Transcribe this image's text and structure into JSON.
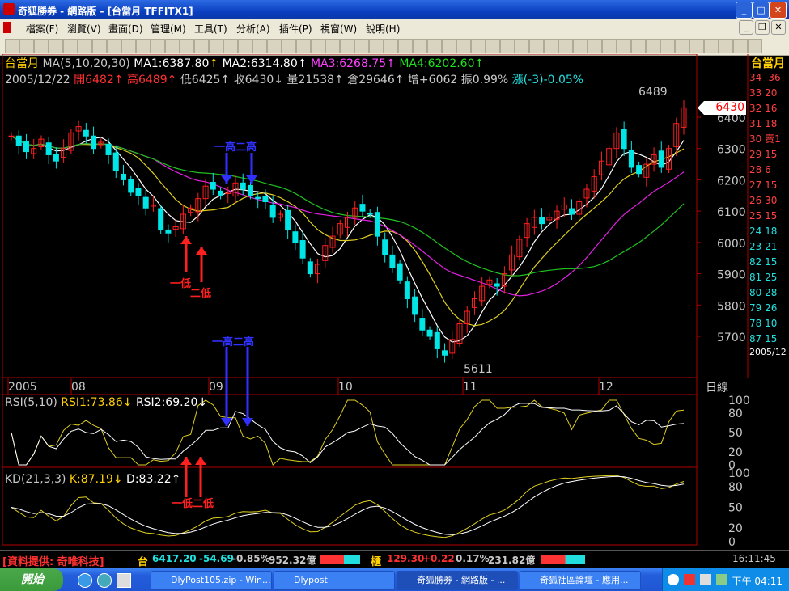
{
  "window": {
    "title": "奇狐勝券 - 網路版 - [台當月 TFFITX1]"
  },
  "menu": [
    "檔案(F)",
    "瀏覽(V)",
    "畫面(D)",
    "管理(M)",
    "工具(T)",
    "分析(A)",
    "插件(P)",
    "視窗(W)",
    "說明(H)"
  ],
  "chart_header": {
    "symbol": "台當月",
    "ma_label": "MA(5,10,20,30)",
    "ma1": "MA1:6387.80",
    "ma2": "MA2:6314.80",
    "ma3": "MA3:6268.75",
    "ma4": "MA4:6202.60",
    "date": "2005/12/22",
    "open": "開6482",
    "high": "高6489",
    "low": "低6425",
    "close": "收6430",
    "volume": "量21538",
    "oi": "倉29646",
    "oi_change": "增+6062",
    "amplitude": "振0.99%",
    "change": "漲(-3)-0.05%",
    "arrow_up": "↑",
    "arrow_down": "↓"
  },
  "annotations": {
    "high_label": "一高二高",
    "low1": "一低",
    "low2": "二低",
    "low_combined": "一低二低",
    "peak_value": "6489",
    "trough_value": "5611",
    "last_price": "6430"
  },
  "rsi_header": {
    "label": "RSI(5,10)",
    "rsi1": "RSI1:73.86",
    "rsi2": "RSI2:69.20"
  },
  "kd_header": {
    "label": "KD(21,3,3)",
    "k": "K:87.19",
    "d": "D:83.22"
  },
  "period_label": "日線",
  "colors": {
    "up": "#ff2020",
    "down": "#00e5e5",
    "ma1": "#ffffff",
    "ma2": "#e0d020",
    "ma3": "#e020e0",
    "ma4": "#20c020",
    "frame": "#c00000"
  },
  "chart_data": {
    "type": "candlestick",
    "price_axis": [
      5700,
      5800,
      5900,
      6000,
      6100,
      6200,
      6300,
      6400
    ],
    "x_labels": [
      "2005",
      "08",
      "09",
      "10",
      "11",
      "12"
    ],
    "rsi_axis": [
      0,
      20,
      50,
      80,
      100
    ],
    "kd_axis": [
      0,
      20,
      50,
      80,
      100
    ],
    "candles_approx_close": [
      6340,
      6310,
      6290,
      6300,
      6330,
      6280,
      6260,
      6300,
      6350,
      6370,
      6340,
      6300,
      6320,
      6280,
      6230,
      6200,
      6160,
      6150,
      6110,
      6120,
      6040,
      6030,
      6050,
      6090,
      6110,
      6140,
      6180,
      6170,
      6150,
      6160,
      6190,
      6170,
      6150,
      6140,
      6130,
      6080,
      6090,
      6040,
      6000,
      5950,
      5900,
      5930,
      5990,
      6020,
      6060,
      6080,
      6110,
      6100,
      6090,
      6020,
      5960,
      5920,
      5880,
      5820,
      5770,
      5720,
      5700,
      5660,
      5640,
      5690,
      5740,
      5780,
      5820,
      5860,
      5880,
      5860,
      5900,
      5960,
      6010,
      6060,
      6080,
      6060,
      6080,
      6100,
      6120,
      6090,
      6130,
      6170,
      6210,
      6260,
      6300,
      6350,
      6300,
      6240,
      6220,
      6250,
      6280,
      6240,
      6300,
      6380,
      6430
    ]
  },
  "right_panel": {
    "title": "台當月",
    "rows": [
      "34 -36",
      "33 20",
      "32 16",
      "31 18",
      "30 賣1",
      "29 15",
      "28 6",
      "27 15",
      "26 30",
      "25 15",
      "24 18",
      "23 21",
      "82 15",
      "81 25",
      "80 28",
      "79 26",
      "78 10",
      "87 15"
    ],
    "date": "2005/12"
  },
  "infobar": {
    "provider": "[資料提供: 奇唯科技]",
    "tw_label": "台",
    "tw_value": "6417.20",
    "tw_change": "-54.69",
    "tw_pct": "-0.85%",
    "tw_vol": "952.32億",
    "otc_label": "櫃",
    "otc_value": "129.30",
    "otc_change": "+0.22",
    "otc_pct": "0.17%",
    "otc_vol": "231.82億",
    "time": "16:11:45"
  },
  "taskbar": {
    "start": "開始",
    "tasks": [
      "DlyPost105.zip - Win...",
      "Dlypost",
      "奇狐勝券 - 網路版 - ...",
      "奇狐社區論壇 - 應用..."
    ],
    "clock": "下午 04:11"
  }
}
